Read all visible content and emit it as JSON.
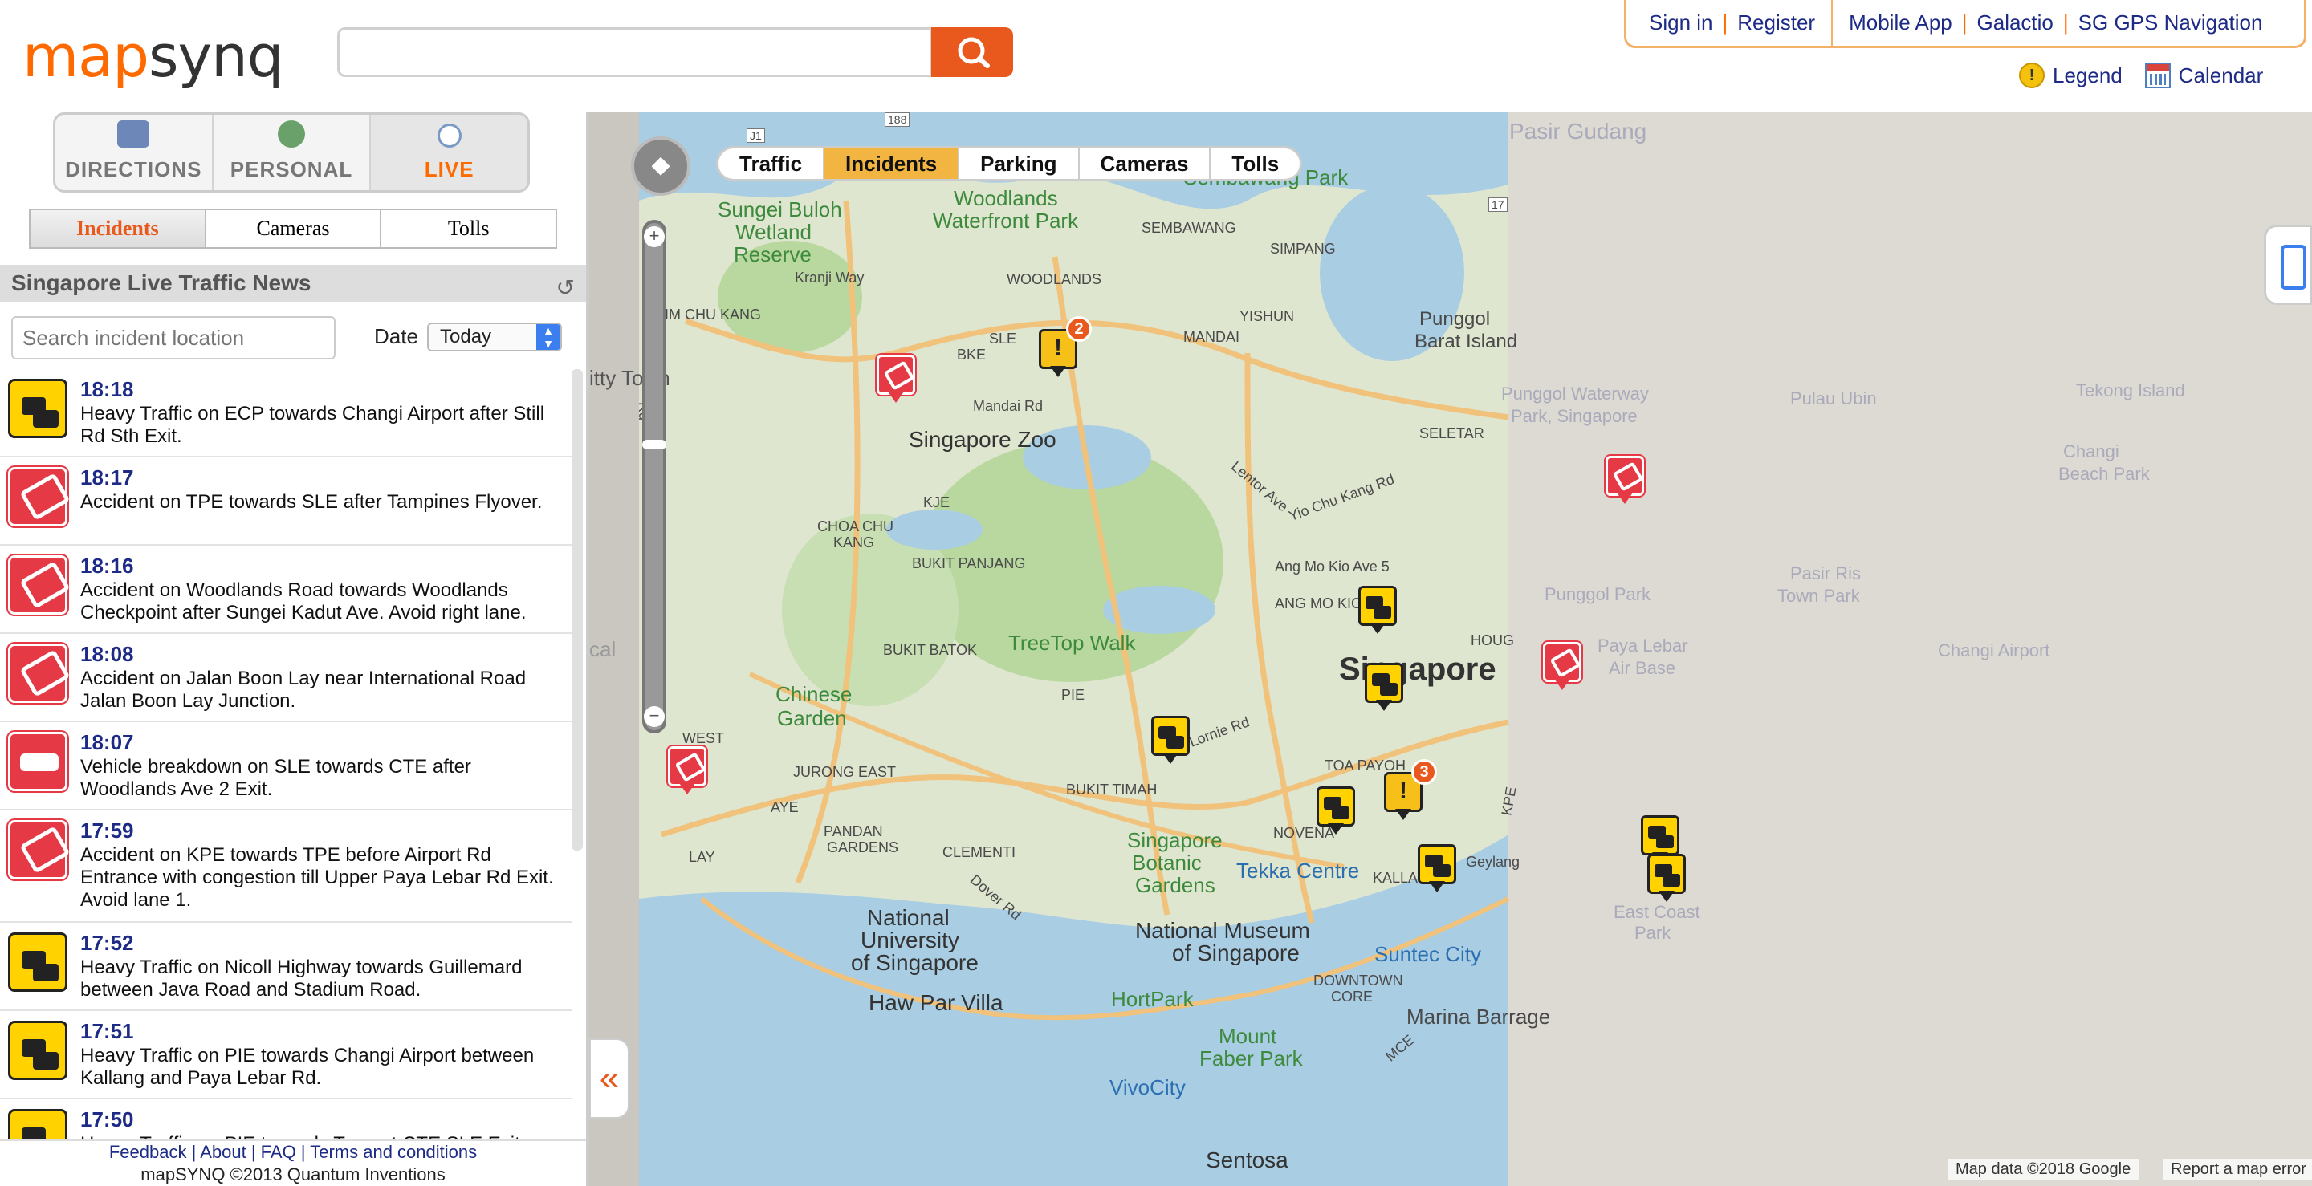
{
  "brand": {
    "logo_left": "map",
    "logo_right": "synq",
    "accent": "#e9581d",
    "link_color": "#1d2b86"
  },
  "header": {
    "search_placeholder": "",
    "sign_in": "Sign in",
    "register": "Register",
    "mobile_app": "Mobile App",
    "galactio": "Galactio",
    "sg_gps": "SG GPS Navigation",
    "legend": "Legend",
    "calendar": "Calendar"
  },
  "modes": [
    {
      "label": "DIRECTIONS",
      "icon": "car-icon"
    },
    {
      "label": "PERSONAL",
      "icon": "user-icon"
    },
    {
      "label": "LIVE",
      "icon": "clock-icon"
    }
  ],
  "subtabs": [
    "Incidents",
    "Cameras",
    "Tolls"
  ],
  "news": {
    "title": "Singapore Live Traffic News",
    "search_placeholder": "Search incident location",
    "date_label": "Date",
    "date_value": "Today"
  },
  "incidents": [
    {
      "type": "traffic",
      "time": "18:18",
      "text": "Heavy Traffic on ECP towards Changi Airport after Still Rd Sth Exit."
    },
    {
      "type": "accident",
      "time": "18:17",
      "text": "Accident on TPE towards SLE after Tampines Flyover."
    },
    {
      "type": "accident",
      "time": "18:16",
      "text": "Accident on Woodlands Road towards Woodlands Checkpoint after Sungei Kadut Ave. Avoid right lane."
    },
    {
      "type": "accident",
      "time": "18:08",
      "text": "Accident on Jalan Boon Lay near International Road Jalan Boon Lay Junction."
    },
    {
      "type": "breakdown",
      "time": "18:07",
      "text": "Vehicle breakdown on SLE towards CTE after Woodlands Ave 2 Exit."
    },
    {
      "type": "accident",
      "time": "17:59",
      "text": "Accident on KPE towards TPE before Airport Rd Entrance with congestion till Upper Paya Lebar Rd Exit. Avoid lane 1."
    },
    {
      "type": "traffic",
      "time": "17:52",
      "text": "Heavy Traffic on Nicoll Highway towards Guillemard between Java Road and Stadium Road."
    },
    {
      "type": "traffic",
      "time": "17:51",
      "text": "Heavy Traffic on PIE towards Changi Airport between Kallang and Paya Lebar Rd."
    },
    {
      "type": "traffic",
      "time": "17:50",
      "text": "Heavy Traffic on PIE towards Tuas at CTE SLE Exit."
    }
  ],
  "footer": {
    "feedback": "Feedback",
    "about": "About",
    "faq": "FAQ",
    "terms": "Terms and conditions",
    "copyright": "mapSYNQ ©2013 Quantum Inventions"
  },
  "map": {
    "tabs": [
      "Traffic",
      "Incidents",
      "Parking",
      "Cameras",
      "Tolls"
    ],
    "active_tab": "Incidents",
    "attribution": "Map data ©2018 Google",
    "report": "Report a map error",
    "labels": [
      "Pasir Gudang",
      "Sungei Buloh",
      "Wetland",
      "Reserve",
      "Woodlands",
      "Waterfront Park",
      "Sembawang Park",
      "SEMBAWANG",
      "SIMPANG",
      "WOODLANDS",
      "YISHUN",
      "MANDAI",
      "LIM CHU KANG",
      "Kranji Way",
      "SLE",
      "BKE",
      "Mandai Rd",
      "Singapore Zoo",
      "Punggol",
      "Barat Island",
      "Punggol Waterway",
      "Park, Singapore",
      "Pulau Ubin",
      "Tekong Island",
      "SELETAR",
      "Changi",
      "Beach Park",
      "KJE",
      "CHOA CHU",
      "KANG",
      "BUKIT PANJANG",
      "Lentor Ave",
      "Yio Chu Kang Rd",
      "Ang Mo Kio Ave 5",
      "ANG MO KIO",
      "Pasir Ris",
      "Town Park",
      "Punggol Park",
      "TreeTop Walk",
      "BUKIT BATOK",
      "Singapore",
      "HOUG",
      "Paya Lebar",
      "Air Base",
      "Changi Airport",
      "Chinese",
      "Garden",
      "PIE",
      "Lornie Rd",
      "WEST",
      "JURONG EAST",
      "BUKIT TIMAH",
      "TOA PAYOH",
      "AYE",
      "PANDAN",
      "GARDENS",
      "CLEMENTI",
      "Singapore",
      "Botanic",
      "Gardens",
      "NOVENA",
      "Tekka Centre",
      "KALLANG",
      "Geylang",
      "KPE",
      "LAY",
      "National",
      "University",
      "of Singapore",
      "National Museum",
      "of Singapore",
      "Suntec City",
      "Dover Rd",
      "Haw Par Villa",
      "HortPark",
      "DOWNTOWN",
      "CORE",
      "Marina Barrage",
      "Mount",
      "Faber Park",
      "MCE",
      "VivoCity",
      "Sentosa",
      "East Coast",
      "Park",
      "itty Town",
      "cal",
      "Rd",
      "J1",
      "188",
      "17"
    ]
  },
  "pins": [
    {
      "type": "warn",
      "count": "2"
    },
    {
      "type": "accident"
    },
    {
      "type": "accident"
    },
    {
      "type": "accident"
    },
    {
      "type": "accident"
    },
    {
      "type": "traffic"
    },
    {
      "type": "traffic"
    },
    {
      "type": "traffic"
    },
    {
      "type": "traffic"
    },
    {
      "type": "warn",
      "count": "3"
    },
    {
      "type": "traffic"
    },
    {
      "type": "traffic"
    },
    {
      "type": "traffic"
    }
  ]
}
